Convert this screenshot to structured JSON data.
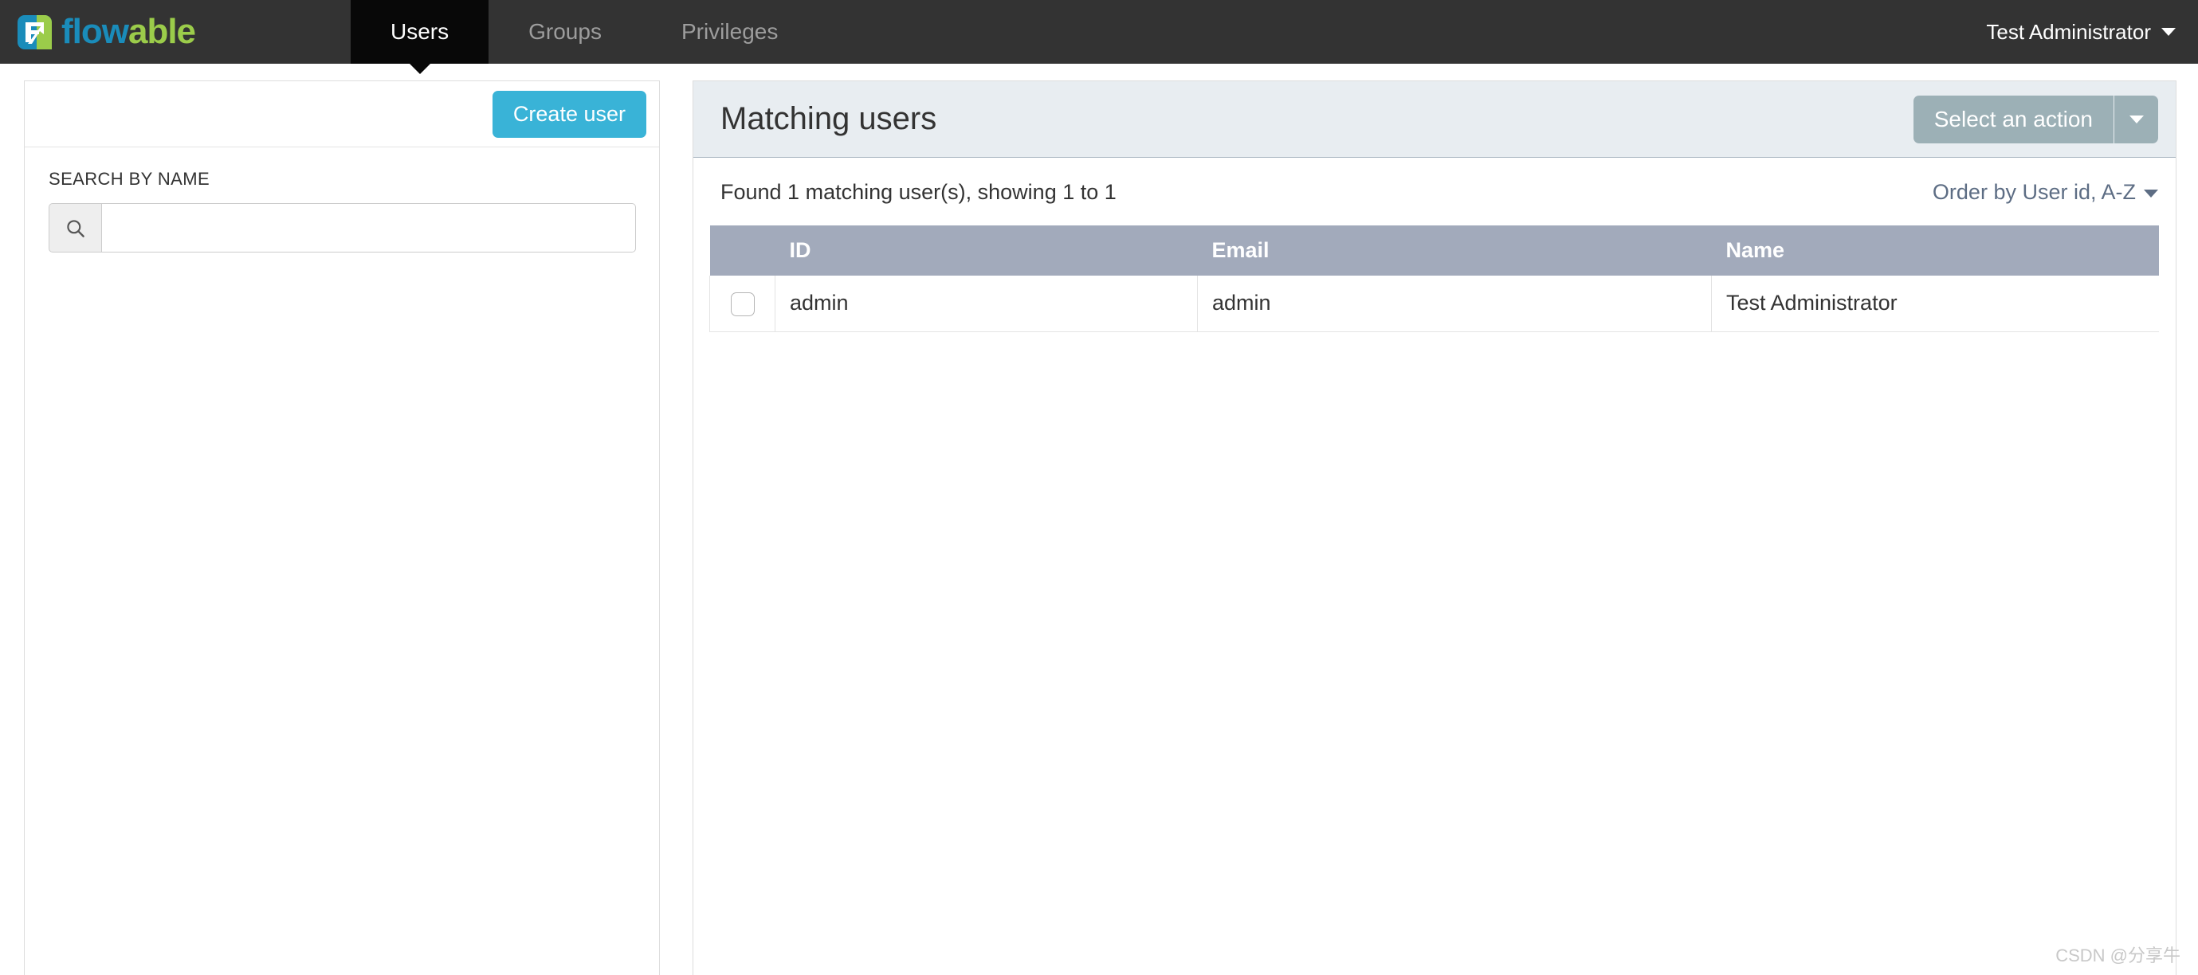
{
  "navbar": {
    "brand": {
      "icon_name": "flowable-logo-icon",
      "word_blue": "flow",
      "word_green": "able",
      "colors": {
        "blue": "#1a8cba",
        "green": "#9bcc4a",
        "navbar_bg": "#333333",
        "active_tab_bg": "#080808"
      }
    },
    "tabs": [
      {
        "label": "Users",
        "active": true
      },
      {
        "label": "Groups",
        "active": false
      },
      {
        "label": "Privileges",
        "active": false
      }
    ],
    "user_menu": {
      "label": "Test Administrator",
      "caret_icon": "chevron-down-icon"
    }
  },
  "left_panel": {
    "create_user_label": "Create user",
    "create_user_color": "#39b3d7",
    "search_label": "SEARCH BY NAME",
    "search_icon": "search-icon",
    "search_value": "",
    "search_placeholder": ""
  },
  "main_panel": {
    "title": "Matching users",
    "header_bg": "#e8edf1",
    "action_button": {
      "label": "Select an action",
      "color": "#9cb0b6",
      "toggle_icon": "caret-down-icon"
    },
    "results_count": "Found 1 matching user(s), showing 1 to 1",
    "order_by": {
      "label": "Order by User id, A-Z",
      "color": "#5d6d84",
      "caret_icon": "caret-down-icon"
    },
    "table": {
      "header_bg": "#a2aabb",
      "columns": [
        "",
        "ID",
        "Email",
        "Name"
      ],
      "rows": [
        {
          "checkbox_name": "row-select-checkbox",
          "id": "admin",
          "email": "admin",
          "name": "Test Administrator"
        }
      ]
    }
  },
  "watermark": {
    "text": "CSDN @分享牛"
  }
}
